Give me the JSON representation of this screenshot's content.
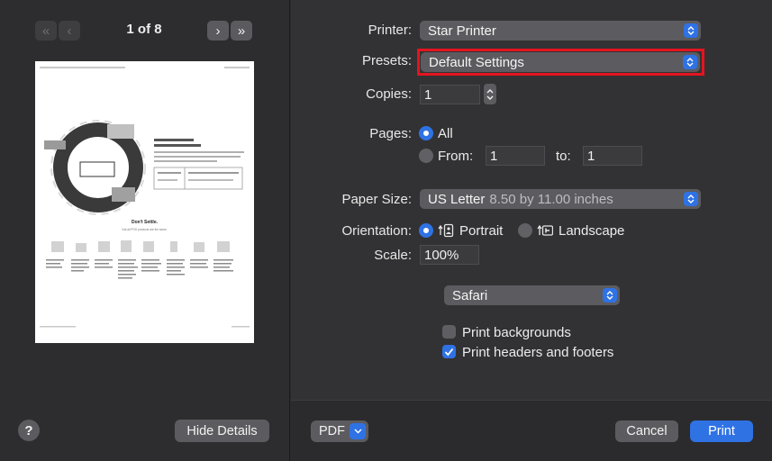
{
  "preview": {
    "page_indicator": "1 of 8",
    "help_label": "?",
    "hide_details_label": "Hide Details",
    "sheet": {
      "headline": "Don't Settle.",
      "tagline": "Not all POS products are the same."
    }
  },
  "settings": {
    "printer": {
      "label": "Printer:",
      "value": "Star Printer"
    },
    "presets": {
      "label": "Presets:",
      "value": "Default Settings",
      "highlight_color": "#e4141f"
    },
    "copies": {
      "label": "Copies:",
      "value": "1"
    },
    "pages": {
      "label": "Pages:",
      "all_label": "All",
      "from_label": "From:",
      "from_value": "1",
      "to_label": "to:",
      "to_value": "1",
      "selected": "All"
    },
    "paper_size": {
      "label": "Paper Size:",
      "value": "US Letter",
      "detail": "8.50 by 11.00 inches"
    },
    "orientation": {
      "label": "Orientation:",
      "portrait_label": "Portrait",
      "landscape_label": "Landscape",
      "selected": "Portrait"
    },
    "scale": {
      "label": "Scale:",
      "value": "100%"
    },
    "app_section": {
      "value": "Safari"
    },
    "print_backgrounds": {
      "label": "Print backgrounds",
      "checked": false
    },
    "print_headers_footers": {
      "label": "Print headers and footers",
      "checked": true
    }
  },
  "footer": {
    "pdf_label": "PDF",
    "cancel_label": "Cancel",
    "print_label": "Print"
  },
  "colors": {
    "accent": "#2f72e4",
    "panel": "#323234",
    "control": "#5c5b5f"
  }
}
